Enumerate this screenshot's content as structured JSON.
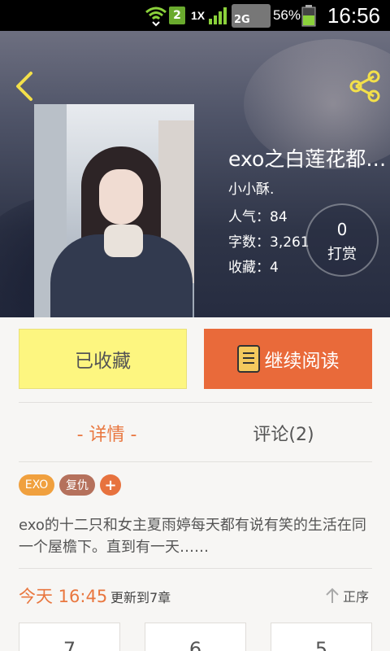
{
  "status_bar": {
    "sim_slot": "2",
    "network_1x": "1X",
    "network_2g": "2G",
    "battery": "56%",
    "time": "16:56",
    "icons": [
      "wifi-icon",
      "signal-icon",
      "battery-icon"
    ]
  },
  "header": {
    "back_icon": "chevron-left-icon",
    "share_icon": "share-icon"
  },
  "book": {
    "title": "exo之白莲花都…",
    "author": "小小酥.",
    "popularity": "人气：84",
    "word_count": "字数：3,261",
    "favorites": "收藏：4",
    "reward_count": "0",
    "reward_label": "打赏"
  },
  "actions": {
    "favorited_label": "已收藏",
    "continue_label": "继续阅读"
  },
  "tabs": [
    {
      "label": "- 详情 -",
      "active": true
    },
    {
      "label": "评论(2)",
      "active": false
    }
  ],
  "tags": [
    "EXO",
    "复仇",
    "+"
  ],
  "synopsis": "exo的十二只和女主夏雨婷每天都有说有笑的生活在同一个屋檐下。直到有一天……",
  "update": {
    "time": "今天 16:45",
    "text": "更新到7章",
    "sort_label": "正序"
  },
  "chapters": [
    "7",
    "6",
    "5"
  ],
  "colors": {
    "accent": "#e9773f",
    "read_button": "#e96a3a",
    "fav_button": "#fdf680",
    "share_icon": "#f3e04a"
  }
}
